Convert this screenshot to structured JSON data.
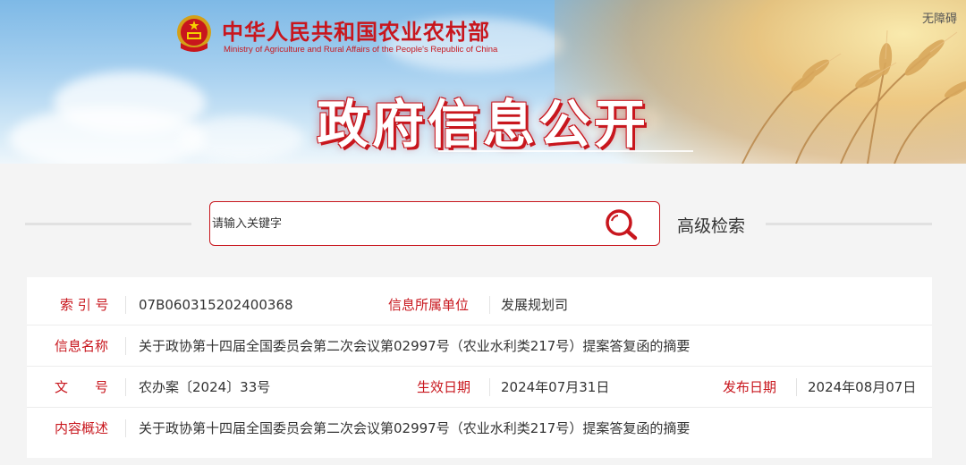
{
  "header": {
    "ministry_cn": "中华人民共和国农业农村部",
    "ministry_en": "Ministry of Agriculture and Rural Affairs of the People's Republic of China",
    "accessibility": "无障碍",
    "banner_title": "政府信息公开"
  },
  "search": {
    "placeholder": "请输入关键字",
    "advanced_label": "高级检索"
  },
  "info": {
    "index_label": "索 引 号",
    "index_value": "07B060315202400368",
    "unit_label": "信息所属单位",
    "unit_value": "发展规划司",
    "name_label": "信息名称",
    "name_value": "关于政协第十四届全国委员会第二次会议第02997号（农业水利类217号）提案答复函的摘要",
    "doc_label": "文　　号",
    "doc_value": "农办案〔2024〕33号",
    "effective_label": "生效日期",
    "effective_value": "2024年07月31日",
    "publish_label": "发布日期",
    "publish_value": "2024年08月07日",
    "summary_label": "内容概述",
    "summary_value": "关于政协第十四届全国委员会第二次会议第02997号（农业水利类217号）提案答复函的摘要"
  },
  "colors": {
    "brand_red": "#c8161d",
    "text": "#333333"
  }
}
